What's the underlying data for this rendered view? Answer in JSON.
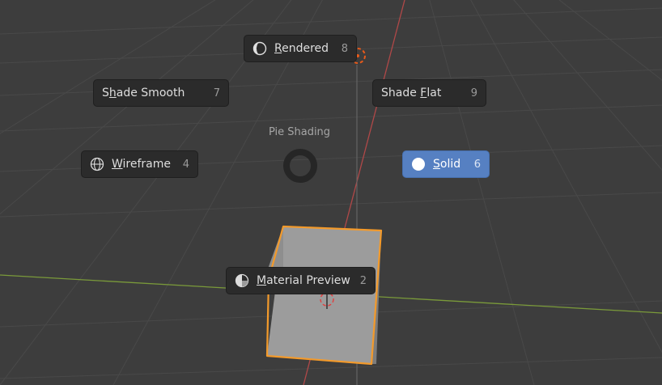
{
  "pie_menu": {
    "title": "Pie Shading",
    "items": [
      {
        "id": "rendered",
        "pre": "",
        "u": "R",
        "post": "endered",
        "key": "8",
        "icon": "rendered-shading-icon"
      },
      {
        "id": "shade-smooth",
        "pre": "S",
        "u": "h",
        "post": "ade Smooth",
        "key": "7",
        "icon": ""
      },
      {
        "id": "shade-flat",
        "pre": "Shade ",
        "u": "F",
        "post": "lat",
        "key": "9",
        "icon": ""
      },
      {
        "id": "wireframe",
        "pre": "",
        "u": "W",
        "post": "ireframe",
        "key": "4",
        "icon": "wireframe-shading-icon"
      },
      {
        "id": "solid",
        "pre": "",
        "u": "S",
        "post": "olid",
        "key": "6",
        "icon": "solid-shading-icon",
        "active": true
      },
      {
        "id": "material-preview",
        "pre": "",
        "u": "M",
        "post": "aterial Preview",
        "key": "2",
        "icon": "material-preview-shading-icon"
      }
    ]
  },
  "colors": {
    "background": "#3d3d3d",
    "grid": "#4a4a4a",
    "x_axis": "#7a9a3a",
    "y_axis": "#b04848",
    "selection_outline": "#f39a2b",
    "active_item": "#5680c2"
  }
}
